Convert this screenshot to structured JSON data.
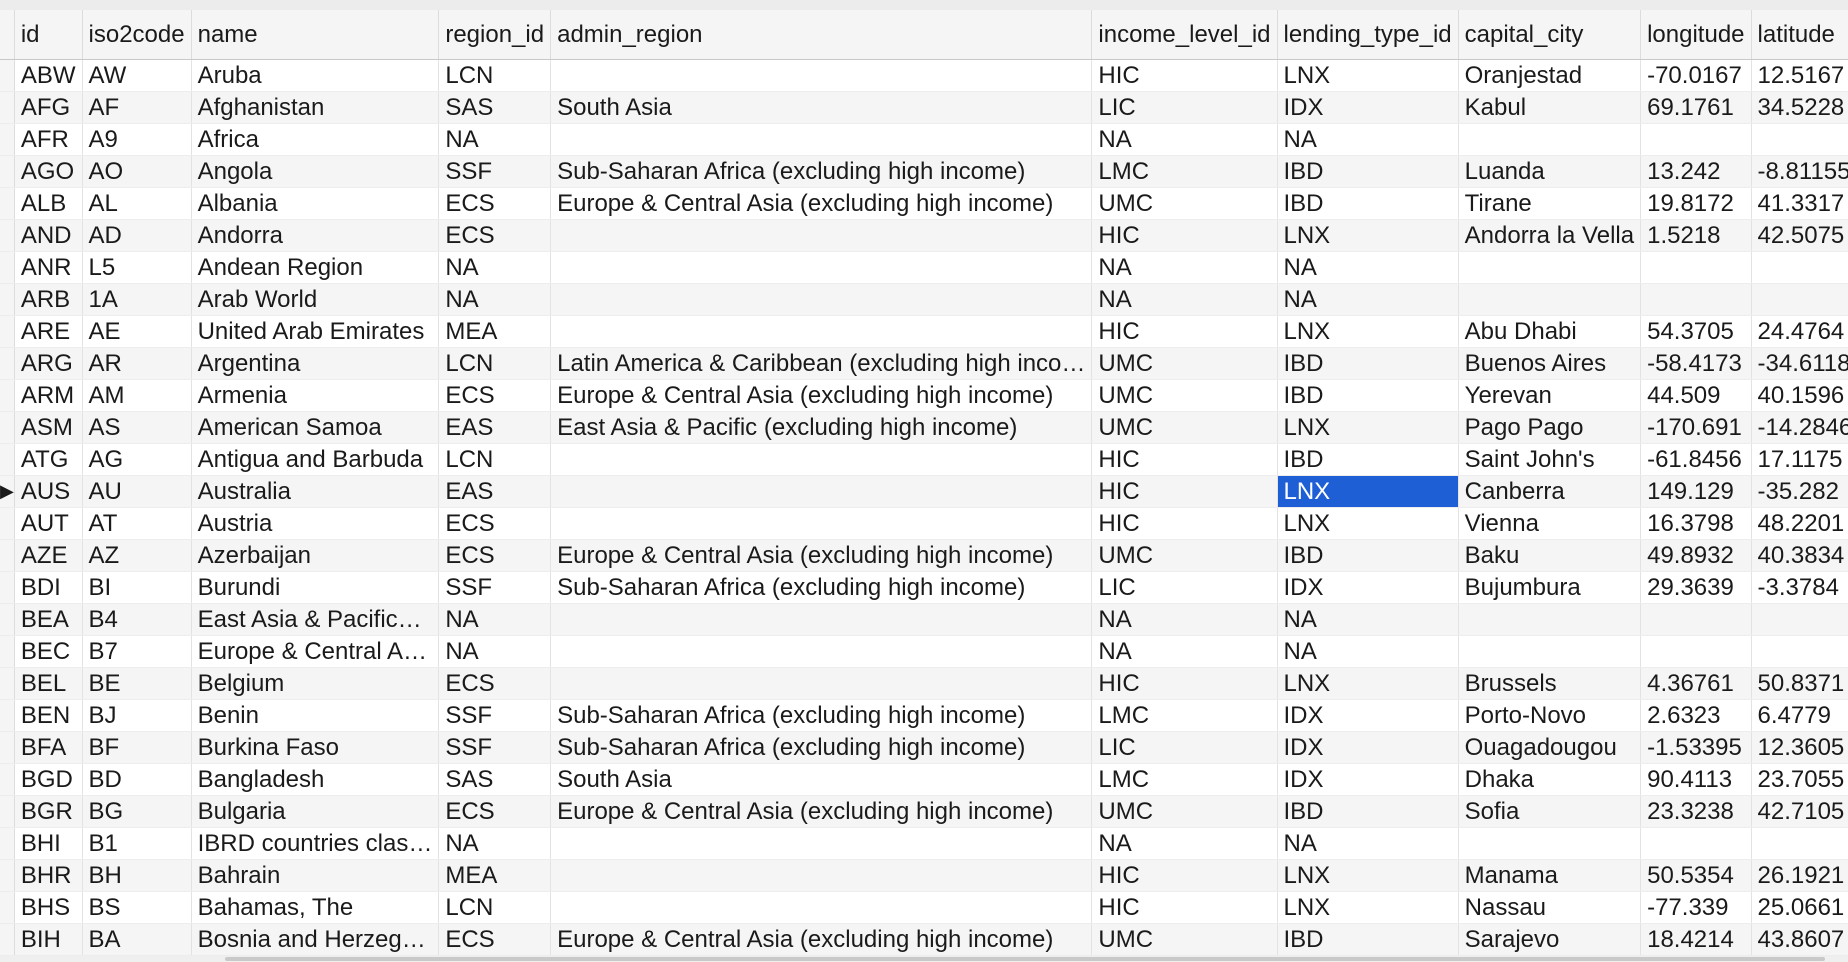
{
  "table": {
    "columns": [
      "id",
      "iso2code",
      "name",
      "region_id",
      "admin_region",
      "income_level_id",
      "lending_type_id",
      "capital_city",
      "longitude",
      "latitude"
    ],
    "current_row_marker": "▶",
    "selected_cell": {
      "row": 13,
      "column": "lending_type_id"
    },
    "selection_color": "#1f5fd6",
    "rows": [
      [
        "ABW",
        "AW",
        "Aruba",
        "LCN",
        "",
        "HIC",
        "LNX",
        "Oranjestad",
        "-70.0167",
        "12.5167"
      ],
      [
        "AFG",
        "AF",
        "Afghanistan",
        "SAS",
        "South Asia",
        "LIC",
        "IDX",
        "Kabul",
        "69.1761",
        "34.5228"
      ],
      [
        "AFR",
        "A9",
        "Africa",
        "NA",
        "",
        "NA",
        "NA",
        "",
        "",
        ""
      ],
      [
        "AGO",
        "AO",
        "Angola",
        "SSF",
        "Sub-Saharan Africa (excluding high income)",
        "LMC",
        "IBD",
        "Luanda",
        "13.242",
        "-8.81155"
      ],
      [
        "ALB",
        "AL",
        "Albania",
        "ECS",
        "Europe & Central Asia (excluding high income)",
        "UMC",
        "IBD",
        "Tirane",
        "19.8172",
        "41.3317"
      ],
      [
        "AND",
        "AD",
        "Andorra",
        "ECS",
        "",
        "HIC",
        "LNX",
        "Andorra la Vella",
        "1.5218",
        "42.5075"
      ],
      [
        "ANR",
        "L5",
        "Andean Region",
        "NA",
        "",
        "NA",
        "NA",
        "",
        "",
        ""
      ],
      [
        "ARB",
        "1A",
        "Arab World",
        "NA",
        "",
        "NA",
        "NA",
        "",
        "",
        ""
      ],
      [
        "ARE",
        "AE",
        "United Arab Emirates",
        "MEA",
        "",
        "HIC",
        "LNX",
        "Abu Dhabi",
        "54.3705",
        "24.4764"
      ],
      [
        "ARG",
        "AR",
        "Argentina",
        "LCN",
        "Latin America & Caribbean (excluding high inco…",
        "UMC",
        "IBD",
        "Buenos Aires",
        "-58.4173",
        "-34.6118"
      ],
      [
        "ARM",
        "AM",
        "Armenia",
        "ECS",
        "Europe & Central Asia (excluding high income)",
        "UMC",
        "IBD",
        "Yerevan",
        "44.509",
        "40.1596"
      ],
      [
        "ASM",
        "AS",
        "American Samoa",
        "EAS",
        "East Asia & Pacific (excluding high income)",
        "UMC",
        "LNX",
        "Pago Pago",
        "-170.691",
        "-14.2846"
      ],
      [
        "ATG",
        "AG",
        "Antigua and Barbuda",
        "LCN",
        "",
        "HIC",
        "IBD",
        "Saint John's",
        "-61.8456",
        "17.1175"
      ],
      [
        "AUS",
        "AU",
        "Australia",
        "EAS",
        "",
        "HIC",
        "LNX",
        "Canberra",
        "149.129",
        "-35.282"
      ],
      [
        "AUT",
        "AT",
        "Austria",
        "ECS",
        "",
        "HIC",
        "LNX",
        "Vienna",
        "16.3798",
        "48.2201"
      ],
      [
        "AZE",
        "AZ",
        "Azerbaijan",
        "ECS",
        "Europe & Central Asia (excluding high income)",
        "UMC",
        "IBD",
        "Baku",
        "49.8932",
        "40.3834"
      ],
      [
        "BDI",
        "BI",
        "Burundi",
        "SSF",
        "Sub-Saharan Africa (excluding high income)",
        "LIC",
        "IDX",
        "Bujumbura",
        "29.3639",
        "-3.3784"
      ],
      [
        "BEA",
        "B4",
        "East Asia & Pacific…",
        "NA",
        "",
        "NA",
        "NA",
        "",
        "",
        ""
      ],
      [
        "BEC",
        "B7",
        "Europe & Central A…",
        "NA",
        "",
        "NA",
        "NA",
        "",
        "",
        ""
      ],
      [
        "BEL",
        "BE",
        "Belgium",
        "ECS",
        "",
        "HIC",
        "LNX",
        "Brussels",
        "4.36761",
        "50.8371"
      ],
      [
        "BEN",
        "BJ",
        "Benin",
        "SSF",
        "Sub-Saharan Africa (excluding high income)",
        "LMC",
        "IDX",
        "Porto-Novo",
        "2.6323",
        "6.4779"
      ],
      [
        "BFA",
        "BF",
        "Burkina Faso",
        "SSF",
        "Sub-Saharan Africa (excluding high income)",
        "LIC",
        "IDX",
        "Ouagadougou",
        "-1.53395",
        "12.3605"
      ],
      [
        "BGD",
        "BD",
        "Bangladesh",
        "SAS",
        "South Asia",
        "LMC",
        "IDX",
        "Dhaka",
        "90.4113",
        "23.7055"
      ],
      [
        "BGR",
        "BG",
        "Bulgaria",
        "ECS",
        "Europe & Central Asia (excluding high income)",
        "UMC",
        "IBD",
        "Sofia",
        "23.3238",
        "42.7105"
      ],
      [
        "BHI",
        "B1",
        "IBRD countries clas…",
        "NA",
        "",
        "NA",
        "NA",
        "",
        "",
        ""
      ],
      [
        "BHR",
        "BH",
        "Bahrain",
        "MEA",
        "",
        "HIC",
        "LNX",
        "Manama",
        "50.5354",
        "26.1921"
      ],
      [
        "BHS",
        "BS",
        "Bahamas, The",
        "LCN",
        "",
        "HIC",
        "LNX",
        "Nassau",
        "-77.339",
        "25.0661"
      ],
      [
        "BIH",
        "BA",
        "Bosnia and Herzeg…",
        "ECS",
        "Europe & Central Asia (excluding high income)",
        "UMC",
        "IBD",
        "Sarajevo",
        "18.4214",
        "43.8607"
      ]
    ]
  }
}
